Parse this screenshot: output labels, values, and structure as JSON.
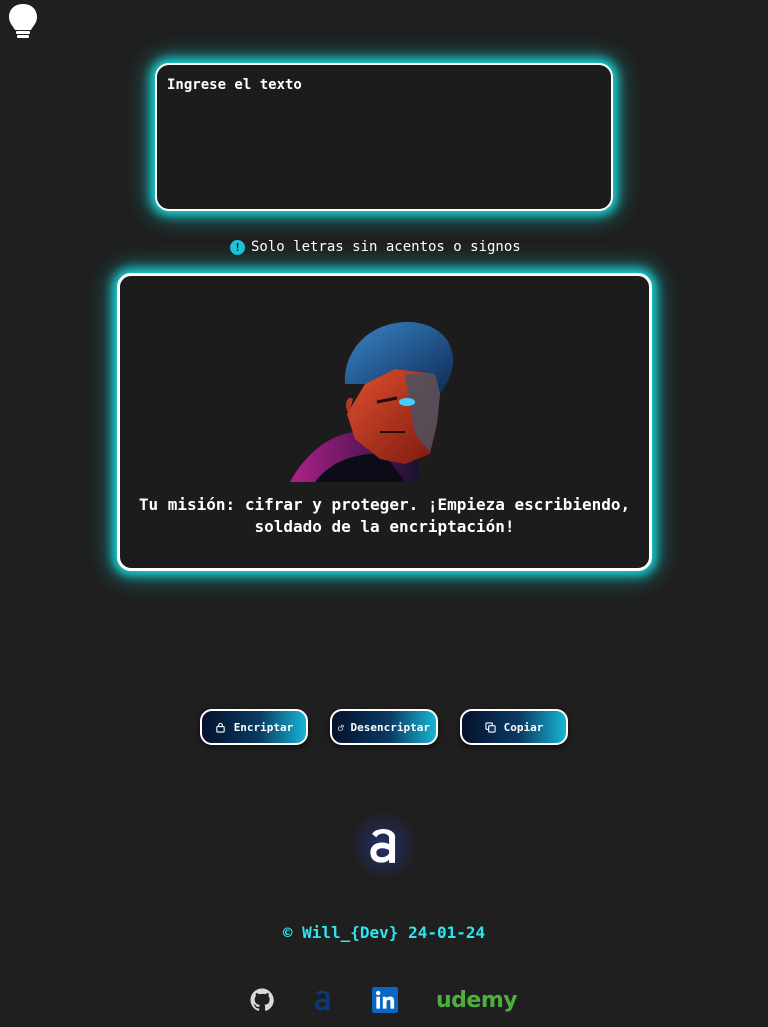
{
  "input": {
    "placeholder": "Ingrese el texto"
  },
  "hint": {
    "icon": "info-icon",
    "text": "Solo letras sin acentos o signos"
  },
  "output": {
    "avatar": "terminator-avatar",
    "message": "Tu misión: cifrar y proteger. ¡Empieza escribiendo, soldado de la encriptación!"
  },
  "buttons": {
    "encrypt_label": "Encriptar",
    "decrypt_label": "Desencriptar",
    "copy_label": "Copiar"
  },
  "footer": {
    "logo_letter": "a",
    "copyright": "© Will_{Dev} 24-01-24",
    "social": {
      "github": "github-icon",
      "alura": "alura-icon",
      "linkedin": "linkedin-icon",
      "udemy": "udemy"
    }
  },
  "colors": {
    "background": "#1f1f1f",
    "glow": "#19d5d8",
    "copyright": "#2ee6ee",
    "udemy_green": "#4fae3c",
    "linkedin_blue": "#0a66c2",
    "alura_blue": "#0b3a7a"
  }
}
